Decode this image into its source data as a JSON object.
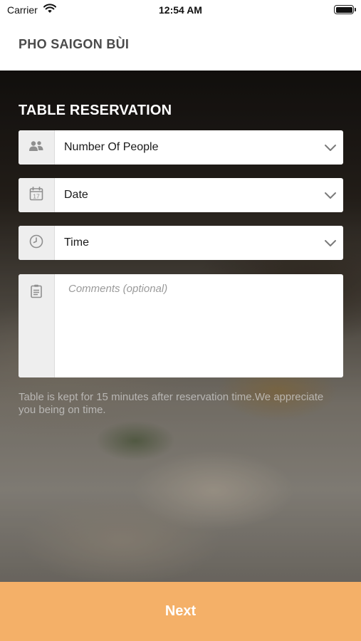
{
  "status_bar": {
    "carrier": "Carrier",
    "time": "12:54 AM"
  },
  "header": {
    "title": "PHO SAIGON BÙI"
  },
  "reservation": {
    "title": "TABLE RESERVATION",
    "fields": [
      {
        "label": "Number Of People",
        "icon": "people-icon"
      },
      {
        "label": "Date",
        "icon": "calendar-icon",
        "icon_text": "17"
      },
      {
        "label": "Time",
        "icon": "clock-icon"
      }
    ],
    "comments": {
      "placeholder": "Comments (optional)",
      "icon": "notepad-icon"
    },
    "note": "Table is kept for 15 minutes after reservation time.We appreciate you being on time."
  },
  "footer": {
    "next_label": "Next"
  },
  "colors": {
    "accent": "#f4b068",
    "header_text": "#4a4a4a"
  }
}
